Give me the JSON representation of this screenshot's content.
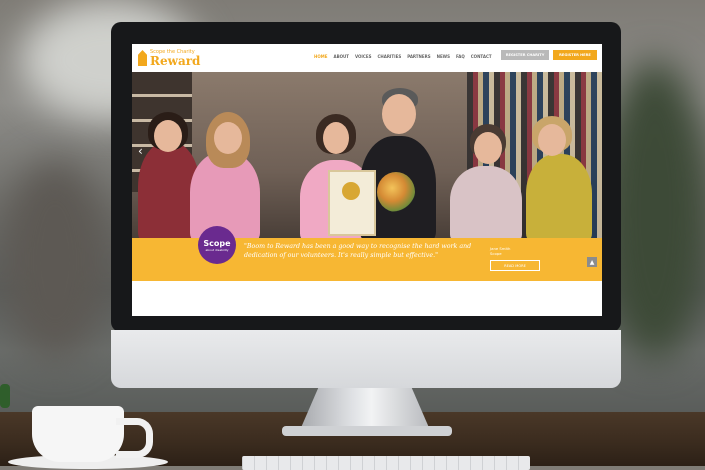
{
  "site": {
    "logo_top": "Scope the Charity",
    "logo_main": "Reward",
    "nav": [
      {
        "label": "HOME",
        "active": true
      },
      {
        "label": "ABOUT",
        "active": false
      },
      {
        "label": "VOICES",
        "active": false
      },
      {
        "label": "CHARITIES",
        "active": false
      },
      {
        "label": "PARTNERS",
        "active": false
      },
      {
        "label": "NEWS",
        "active": false
      },
      {
        "label": "FAQ",
        "active": false
      },
      {
        "label": "CONTACT",
        "active": false
      }
    ],
    "grey_button": "REGISTER CHARITY",
    "yellow_button": "REGISTER HERE",
    "hero": {
      "prev_arrow": "‹"
    },
    "banner": {
      "badge_name": "Scope",
      "badge_tag": "about disability",
      "quote": "\"Boom to Reward has been a good way to recognise the hard work and dedication of our volunteers. It's really simple but effective.\"",
      "small_text_1": "Jane Smith",
      "small_text_2": "Scope",
      "button": "READ MORE"
    },
    "scroll_top_icon": "▲"
  },
  "colors": {
    "accent": "#f2a81d",
    "banner": "#f7b733",
    "badge": "#6a2a8f"
  }
}
